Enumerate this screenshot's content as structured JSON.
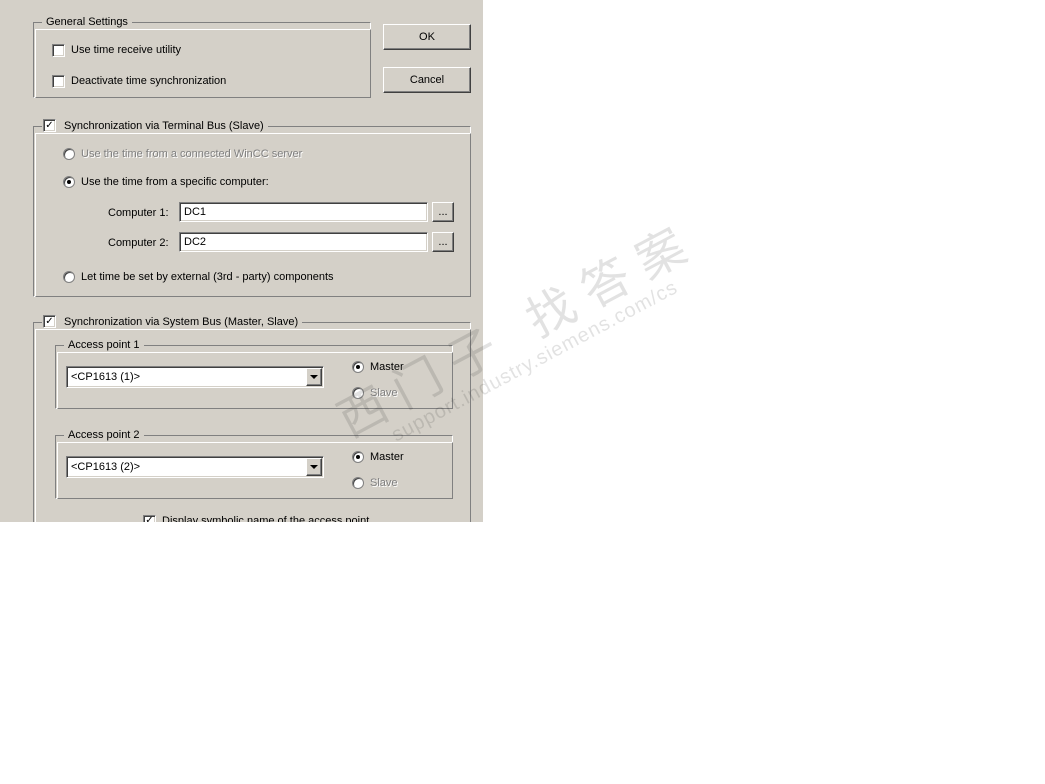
{
  "buttons": {
    "ok": "OK",
    "cancel": "Cancel"
  },
  "general": {
    "legend": "General Settings",
    "use_time_receive_utility": {
      "label": "Use time receive utility",
      "checked": false
    },
    "deactivate_time_sync": {
      "label": "Deactivate time synchronization",
      "checked": false
    }
  },
  "terminal_bus": {
    "enable": {
      "label": "Synchronization via Terminal Bus (Slave)",
      "checked": true
    },
    "opt_server": {
      "label": "Use the time from a connected WinCC server",
      "enabled": false
    },
    "opt_specific": {
      "label": "Use the time from a specific computer:",
      "selected": true
    },
    "computer1_label": "Computer 1:",
    "computer1_value": "DC1",
    "computer2_label": "Computer 2:",
    "computer2_value": "DC2",
    "browse_label": "...",
    "opt_external": {
      "label": "Let time be set by external (3rd - party) components",
      "selected": false
    }
  },
  "system_bus": {
    "enable": {
      "label": "Synchronization via System Bus (Master, Slave)",
      "checked": true
    },
    "ap1_legend": "Access point 1",
    "ap1_value": "<CP1613 (1)>",
    "ap2_legend": "Access point 2",
    "ap2_value": "<CP1613 (2)>",
    "master_label": "Master",
    "slave_label": "Slave",
    "display_symbolic": {
      "label": "Display symbolic name of the access point",
      "checked": true
    }
  },
  "watermark": {
    "line1": "西门子 找答案",
    "line2": "support.industry.siemens.com/cs"
  }
}
